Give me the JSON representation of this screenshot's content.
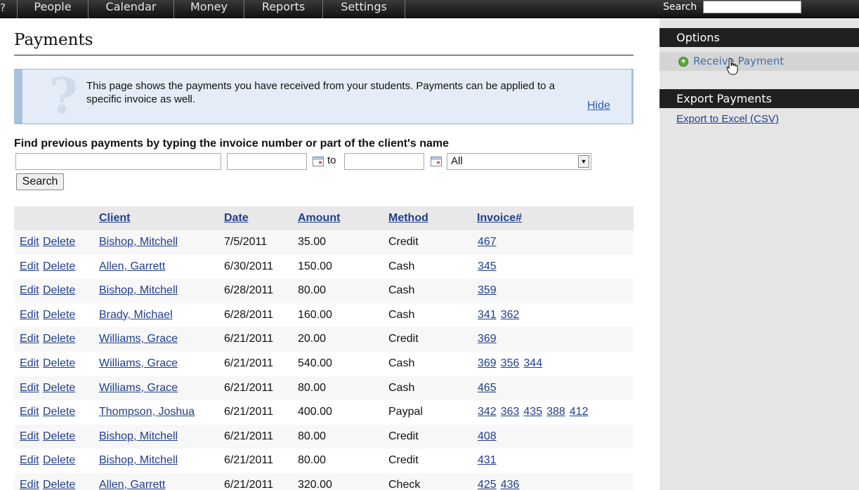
{
  "nav": {
    "help": "?",
    "items": [
      "People",
      "Calendar",
      "Money",
      "Reports",
      "Settings"
    ],
    "search_label": "Search",
    "search_value": ""
  },
  "page": {
    "title": "Payments"
  },
  "info": {
    "text": "This page shows the payments you have received from your students. Payments can be applied to a specific invoice as well.",
    "hide_label": "Hide",
    "icon": "question-mark-icon"
  },
  "filters": {
    "label": "Find previous payments by typing the invoice number or part of the client's name",
    "query_value": "",
    "from_value": "",
    "to_label": "to",
    "to_value": "",
    "method_selected": "All",
    "search_button": "Search"
  },
  "table": {
    "headers": {
      "client": "Client",
      "date": "Date",
      "amount": "Amount",
      "method": "Method",
      "invoice": "Invoice#"
    },
    "action_edit": "Edit",
    "action_delete": "Delete",
    "rows": [
      {
        "client": "Bishop, Mitchell",
        "date": "7/5/2011",
        "amount": "35.00",
        "method": "Credit",
        "invoices": [
          "467"
        ]
      },
      {
        "client": "Allen, Garrett",
        "date": "6/30/2011",
        "amount": "150.00",
        "method": "Cash",
        "invoices": [
          "345"
        ]
      },
      {
        "client": "Bishop, Mitchell",
        "date": "6/28/2011",
        "amount": "80.00",
        "method": "Cash",
        "invoices": [
          "359"
        ]
      },
      {
        "client": "Brady, Michael",
        "date": "6/28/2011",
        "amount": "160.00",
        "method": "Cash",
        "invoices": [
          "341",
          "362"
        ]
      },
      {
        "client": "Williams, Grace",
        "date": "6/21/2011",
        "amount": "20.00",
        "method": "Credit",
        "invoices": [
          "369"
        ]
      },
      {
        "client": "Williams, Grace",
        "date": "6/21/2011",
        "amount": "540.00",
        "method": "Cash",
        "invoices": [
          "369",
          "356",
          "344"
        ]
      },
      {
        "client": "Williams, Grace",
        "date": "6/21/2011",
        "amount": "80.00",
        "method": "Cash",
        "invoices": [
          "465"
        ]
      },
      {
        "client": "Thompson, Joshua",
        "date": "6/21/2011",
        "amount": "400.00",
        "method": "Paypal",
        "invoices": [
          "342",
          "363",
          "435",
          "388",
          "412"
        ]
      },
      {
        "client": "Bishop, Mitchell",
        "date": "6/21/2011",
        "amount": "80.00",
        "method": "Credit",
        "invoices": [
          "408"
        ]
      },
      {
        "client": "Bishop, Mitchell",
        "date": "6/21/2011",
        "amount": "80.00",
        "method": "Credit",
        "invoices": [
          "431"
        ]
      },
      {
        "client": "Allen, Garrett",
        "date": "6/21/2011",
        "amount": "320.00",
        "method": "Check",
        "invoices": [
          "425",
          "436"
        ]
      }
    ]
  },
  "sidebar": {
    "options_header": "Options",
    "receive_payment": "Receive Payment",
    "export_header": "Export Payments",
    "export_link": "Export to Excel (CSV)"
  },
  "colors": {
    "nav_bg": "#1a1a1a",
    "link": "#1f3e8c",
    "info_bg": "#e4edf7",
    "sidebar_bg": "#e5e5e5",
    "plus_green": "#5aa83a"
  }
}
